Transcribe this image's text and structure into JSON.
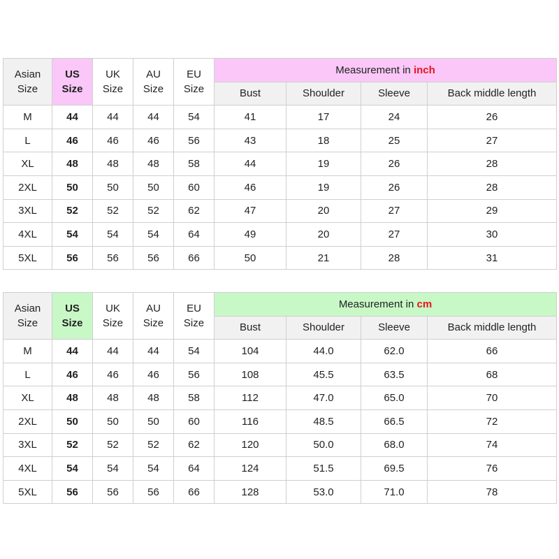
{
  "colors": {
    "inch_accent": "#fac7f8",
    "cm_accent": "#c8f8c6",
    "unit_red": "#e8131c",
    "header_gray": "#f1f1f1"
  },
  "inch_table": {
    "headers": {
      "asian": [
        "Asian",
        "Size"
      ],
      "us": [
        "US",
        "Size"
      ],
      "uk": [
        "UK",
        "Size"
      ],
      "au": [
        "AU",
        "Size"
      ],
      "eu": [
        "EU",
        "Size"
      ],
      "measurement_prefix": "Measurement in ",
      "measurement_unit": "inch",
      "sub": [
        "Bust",
        "Shoulder",
        "Sleeve",
        "Back middle length"
      ]
    },
    "rows": [
      [
        "M",
        "44",
        "44",
        "44",
        "54",
        "41",
        "17",
        "24",
        "26"
      ],
      [
        "L",
        "46",
        "46",
        "46",
        "56",
        "43",
        "18",
        "25",
        "27"
      ],
      [
        "XL",
        "48",
        "48",
        "48",
        "58",
        "44",
        "19",
        "26",
        "28"
      ],
      [
        "2XL",
        "50",
        "50",
        "50",
        "60",
        "46",
        "19",
        "26",
        "28"
      ],
      [
        "3XL",
        "52",
        "52",
        "52",
        "62",
        "47",
        "20",
        "27",
        "29"
      ],
      [
        "4XL",
        "54",
        "54",
        "54",
        "64",
        "49",
        "20",
        "27",
        "30"
      ],
      [
        "5XL",
        "56",
        "56",
        "56",
        "66",
        "50",
        "21",
        "28",
        "31"
      ]
    ]
  },
  "cm_table": {
    "headers": {
      "asian": [
        "Asian",
        "Size"
      ],
      "us": [
        "US",
        "Size"
      ],
      "uk": [
        "UK",
        "Size"
      ],
      "au": [
        "AU",
        "Size"
      ],
      "eu": [
        "EU",
        "Size"
      ],
      "measurement_prefix": "Measurement in ",
      "measurement_unit": "cm",
      "sub": [
        "Bust",
        "Shoulder",
        "Sleeve",
        "Back middle length"
      ]
    },
    "rows": [
      [
        "M",
        "44",
        "44",
        "44",
        "54",
        "104",
        "44.0",
        "62.0",
        "66"
      ],
      [
        "L",
        "46",
        "46",
        "46",
        "56",
        "108",
        "45.5",
        "63.5",
        "68"
      ],
      [
        "XL",
        "48",
        "48",
        "48",
        "58",
        "112",
        "47.0",
        "65.0",
        "70"
      ],
      [
        "2XL",
        "50",
        "50",
        "50",
        "60",
        "116",
        "48.5",
        "66.5",
        "72"
      ],
      [
        "3XL",
        "52",
        "52",
        "52",
        "62",
        "120",
        "50.0",
        "68.0",
        "74"
      ],
      [
        "4XL",
        "54",
        "54",
        "54",
        "64",
        "124",
        "51.5",
        "69.5",
        "76"
      ],
      [
        "5XL",
        "56",
        "56",
        "56",
        "66",
        "128",
        "53.0",
        "71.0",
        "78"
      ]
    ]
  }
}
